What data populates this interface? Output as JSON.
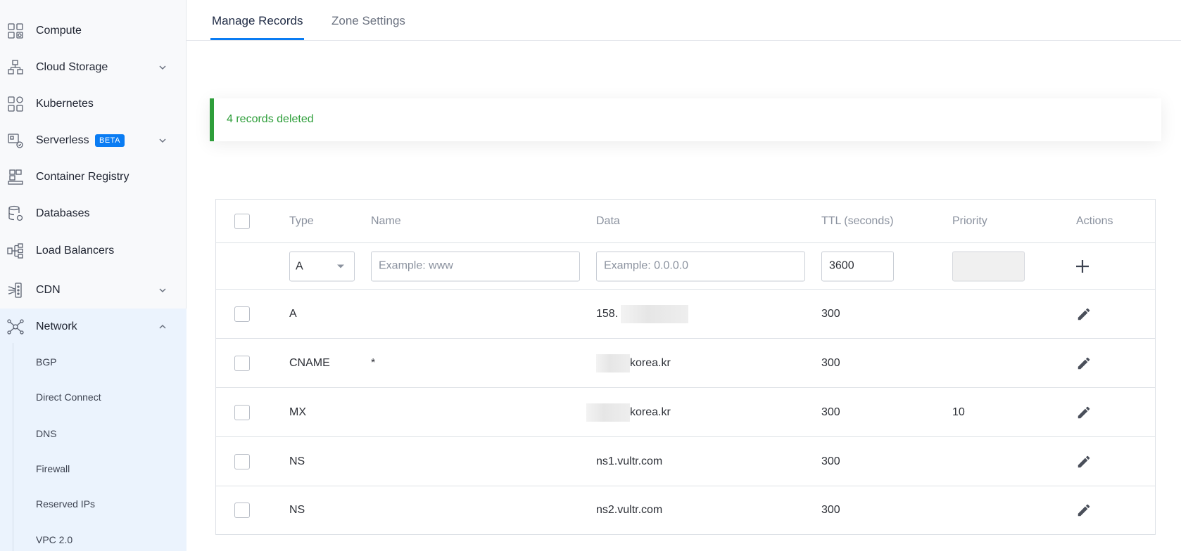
{
  "sidebar": {
    "items": [
      {
        "label": "Compute",
        "icon": "server-grid-icon"
      },
      {
        "label": "Cloud Storage",
        "icon": "storage-blocks-icon"
      },
      {
        "label": "Kubernetes",
        "icon": "kubernetes-grid-icon"
      },
      {
        "label": "Serverless",
        "icon": "serverless-icon",
        "badge": "BETA"
      },
      {
        "label": "Container Registry",
        "icon": "registry-blocks-icon"
      },
      {
        "label": "Databases",
        "icon": "database-icon"
      },
      {
        "label": "Load Balancers",
        "icon": "load-balancer-icon"
      },
      {
        "label": "CDN",
        "icon": "cdn-icon"
      },
      {
        "label": "Network",
        "icon": "network-nodes-icon"
      }
    ],
    "network_sub": [
      "BGP",
      "Direct Connect",
      "DNS",
      "Firewall",
      "Reserved IPs",
      "VPC 2.0"
    ]
  },
  "tabs": [
    {
      "label": "Manage Records",
      "active": true
    },
    {
      "label": "Zone Settings",
      "active": false
    }
  ],
  "alert": {
    "text": "4 records deleted",
    "color": "#2e9e3a"
  },
  "table": {
    "headers": [
      "Type",
      "Name",
      "Data",
      "TTL (seconds)",
      "Priority",
      "Actions"
    ],
    "new_record": {
      "type_value": "A",
      "name_placeholder": "Example: www",
      "data_placeholder": "Example: 0.0.0.0",
      "ttl_value": "3600"
    },
    "rows": [
      {
        "type": "A",
        "name": "",
        "data": "158.",
        "ttl": "300",
        "priority": ""
      },
      {
        "type": "CNAME",
        "name": "*",
        "data": "korea.kr",
        "ttl": "300",
        "priority": ""
      },
      {
        "type": "MX",
        "name": "",
        "data": "korea.kr",
        "ttl": "300",
        "priority": "10"
      },
      {
        "type": "NS",
        "name": "",
        "data": "ns1.vultr.com",
        "ttl": "300",
        "priority": ""
      },
      {
        "type": "NS",
        "name": "",
        "data": "ns2.vultr.com",
        "ttl": "300",
        "priority": ""
      }
    ]
  },
  "colors": {
    "accent": "#0a7cf3",
    "success": "#2e9e3a"
  }
}
